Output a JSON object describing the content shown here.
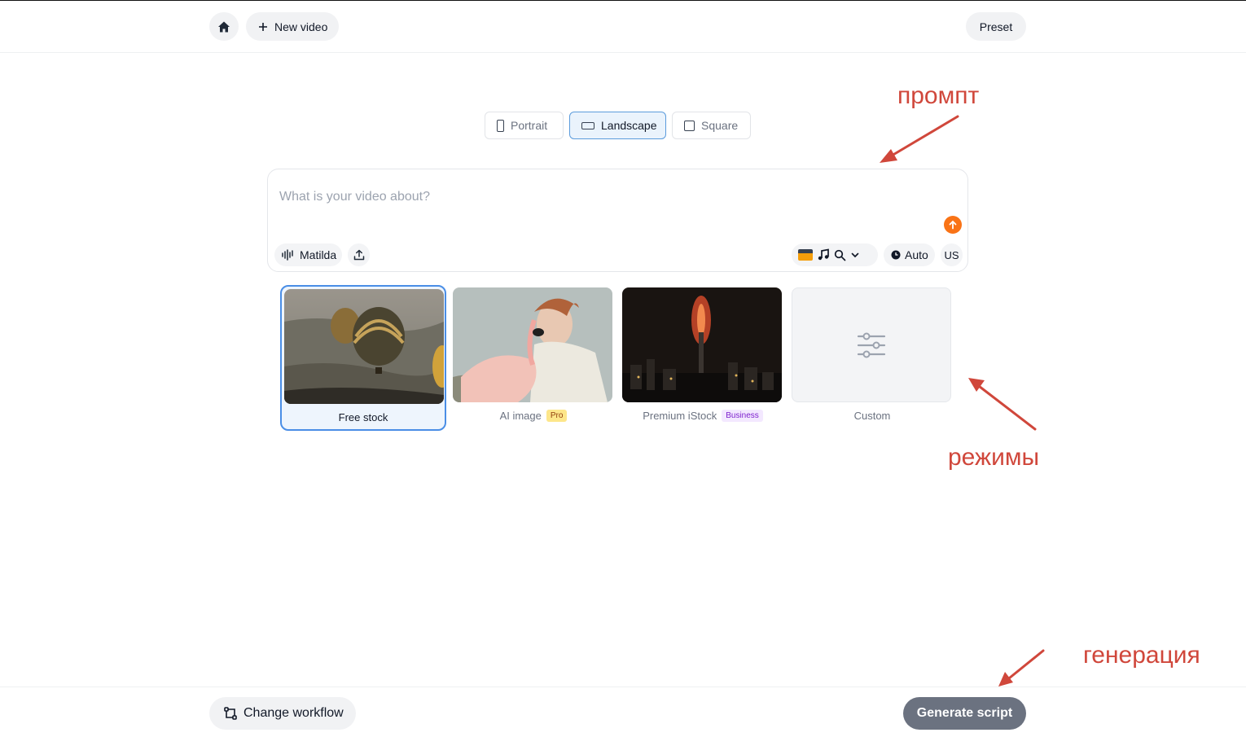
{
  "header": {
    "home_icon": "home-icon",
    "new_video_label": "New video",
    "preset_label": "Preset"
  },
  "orientation": {
    "options": [
      {
        "label": "Portrait",
        "icon": "portrait-icon",
        "selected": false
      },
      {
        "label": "Landscape",
        "icon": "landscape-icon",
        "selected": true
      },
      {
        "label": "Square",
        "icon": "square-icon",
        "selected": false
      }
    ]
  },
  "prompt": {
    "value": "",
    "placeholder": "What is your video about?",
    "voice_label": "Matilda",
    "auto_label": "Auto",
    "lang_label": "US"
  },
  "modes": {
    "items": [
      {
        "label": "Free stock",
        "badge": "",
        "selected": true
      },
      {
        "label": "AI image",
        "badge": "Pro",
        "selected": false
      },
      {
        "label": "Premium iStock",
        "badge": "Business",
        "selected": false
      },
      {
        "label": "Custom",
        "badge": "",
        "selected": false
      }
    ]
  },
  "annotations": {
    "prompt": "промпт",
    "modes": "режимы",
    "generate": "генерация",
    "color": "#d0473b"
  },
  "footer": {
    "change_workflow_label": "Change workflow",
    "generate_label": "Generate script"
  },
  "colors": {
    "accent_orange": "#f97316",
    "selected_blue": "#4a8ee6",
    "generate_gray": "#6b7280"
  }
}
